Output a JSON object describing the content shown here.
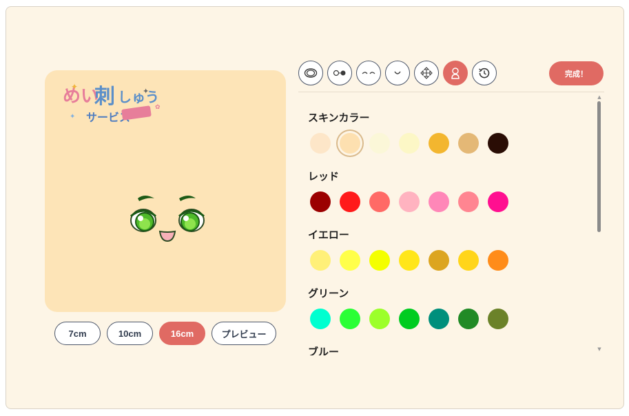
{
  "logo": {
    "text": "めい刺しゅうサービス"
  },
  "sizes": [
    {
      "label": "7cm",
      "active": false
    },
    {
      "label": "10cm",
      "active": false
    },
    {
      "label": "16cm",
      "active": true
    },
    {
      "label": "プレビュー",
      "active": false
    }
  ],
  "tabs": [
    {
      "icon": "face-outline-icon"
    },
    {
      "icon": "eyes-icon"
    },
    {
      "icon": "eyebrows-icon"
    },
    {
      "icon": "mouth-icon"
    },
    {
      "icon": "move-arrows-icon"
    },
    {
      "icon": "person-color-icon",
      "active": true
    },
    {
      "icon": "history-icon"
    }
  ],
  "done_label": "完成！",
  "colors": {
    "accent": "#e06a63",
    "canvas_bg": "#fde4b7",
    "panel_bg": "#fdf5e6"
  },
  "groups": [
    {
      "title": "スキンカラー",
      "swatches": [
        "#fde6c8",
        "#fde0b0",
        "#fbf7d8",
        "#fcf7c6",
        "#f3b62f",
        "#e4b876",
        "#2a0d05"
      ],
      "selected": 1
    },
    {
      "title": "レッド",
      "swatches": [
        "#9b0000",
        "#ff1a1a",
        "#ff6a66",
        "#ffb3c0",
        "#ff87b8",
        "#ff8591",
        "#ff0f90"
      ]
    },
    {
      "title": "イエロー",
      "swatches": [
        "#fff078",
        "#ffff4a",
        "#f4ff00",
        "#ffe61a",
        "#dca520",
        "#ffd51a",
        "#ff8c1a"
      ]
    },
    {
      "title": "グリーン",
      "swatches": [
        "#00ffd0",
        "#2aff36",
        "#9cff2a",
        "#00cc20",
        "#008f7c",
        "#218a26",
        "#6b8229"
      ]
    },
    {
      "title": "ブルー",
      "swatches": []
    }
  ]
}
